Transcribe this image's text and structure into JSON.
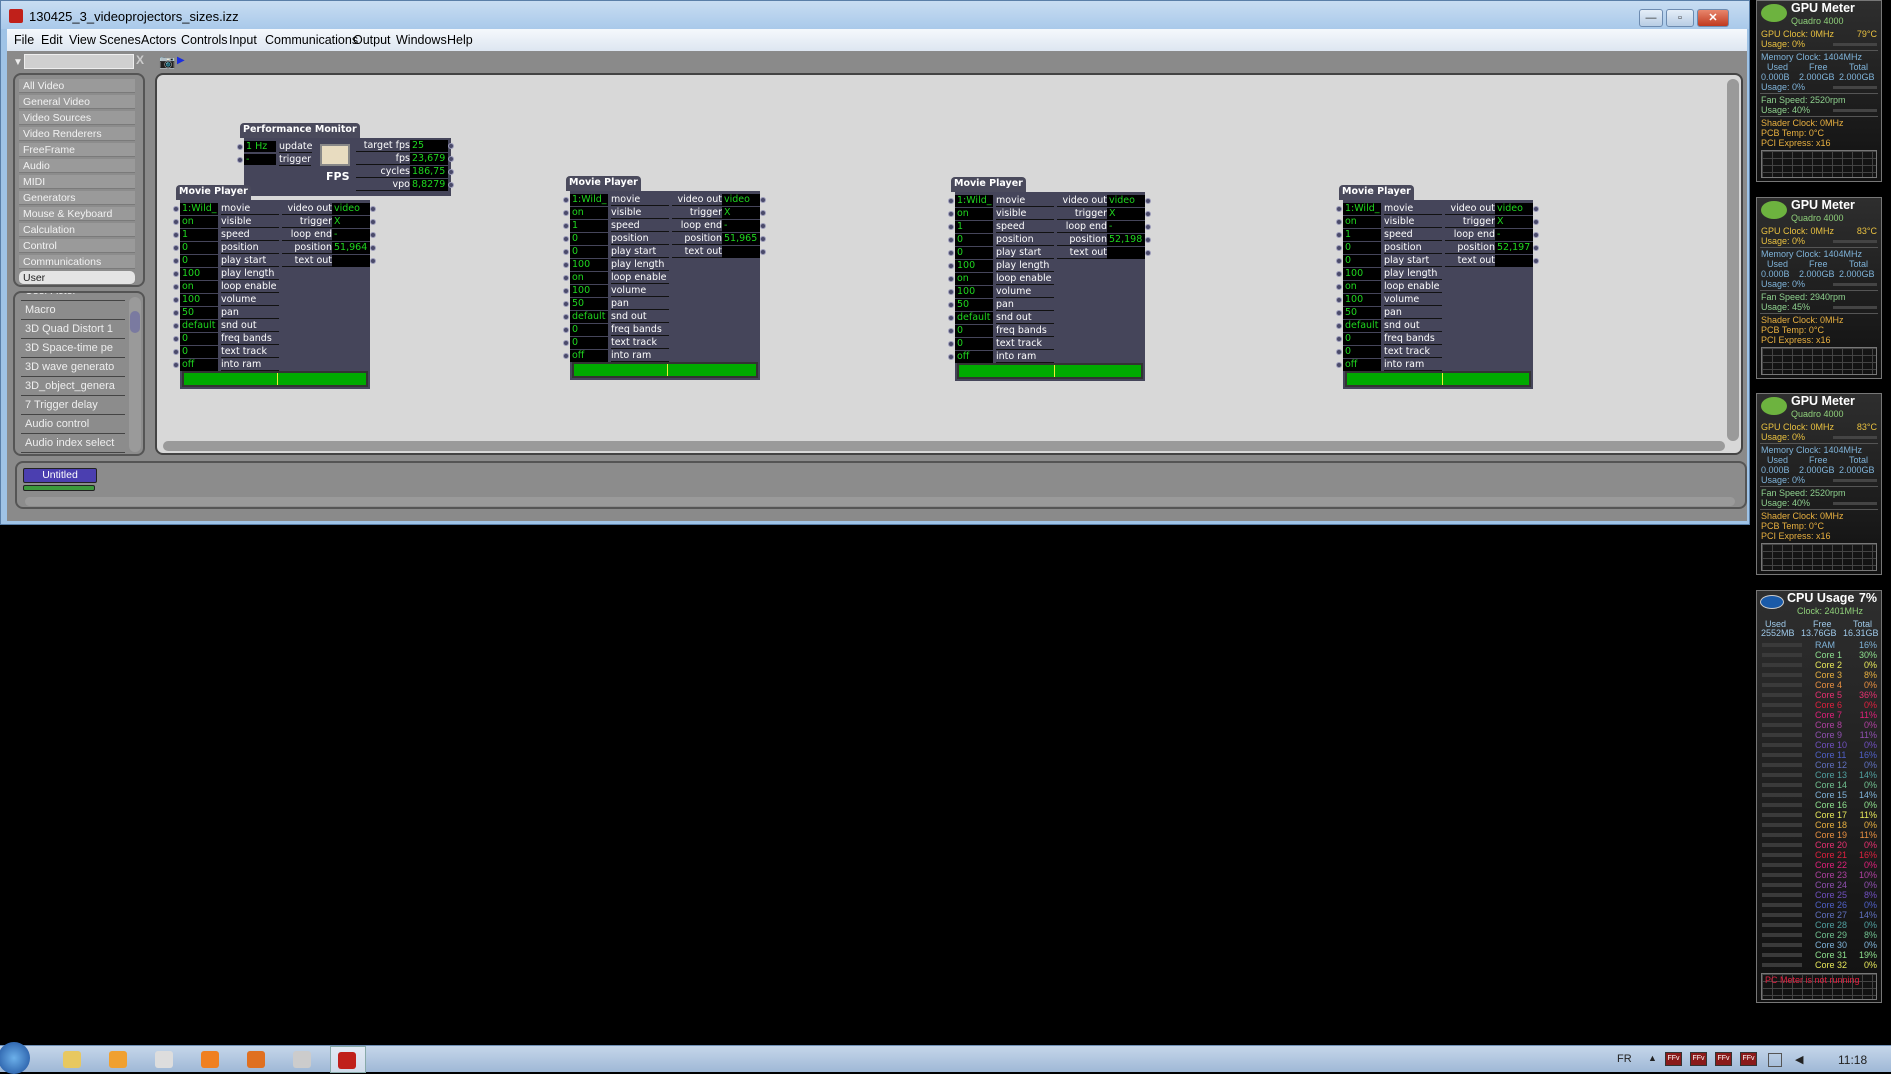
{
  "window": {
    "title": "130425_3_videoprojectors_sizes.izz",
    "controls": {
      "minimize": "—",
      "maximize": "▫",
      "close": "✕"
    },
    "menu": [
      "File",
      "Edit",
      "View",
      "Scenes",
      "Actors",
      "Controls",
      "Input",
      "Communications",
      "Output",
      "Windows",
      "Help"
    ]
  },
  "toolbar": {
    "search_value": "",
    "clear_label": "X"
  },
  "sidebar": {
    "categories": [
      "All Video",
      "General Video",
      "Video Sources",
      "Video Renderers",
      "FreeFrame",
      "Audio",
      "MIDI",
      "Generators",
      "Mouse & Keyboard",
      "Calculation",
      "Control",
      "Communications",
      "User"
    ],
    "selected": "User",
    "actors": [
      "User Actor",
      "Macro",
      "3D Quad Distort 1",
      "3D Space-time pe",
      "3D wave generato",
      "3D_object_genera",
      "7 Trigger delay",
      "Audio control",
      "Audio index select"
    ]
  },
  "performance_monitor": {
    "title": "Performance Monitor",
    "inputs": [
      {
        "value": "1 Hz",
        "label": "update"
      },
      {
        "value": "-",
        "label": "trigger"
      }
    ],
    "icon_label": "FPS",
    "outputs": [
      {
        "label": "target fps",
        "value": "25"
      },
      {
        "label": "fps",
        "value": "23,679"
      },
      {
        "label": "cycles",
        "value": "186,75"
      },
      {
        "label": "vpo",
        "value": "8,8279"
      }
    ]
  },
  "movie_players": [
    {
      "title": "Movie Player",
      "playhead": 0.51,
      "inputs": [
        {
          "value": "1:Wild_",
          "label": "movie"
        },
        {
          "value": "on",
          "label": "visible"
        },
        {
          "value": "1",
          "label": "speed"
        },
        {
          "value": "0",
          "label": "position"
        },
        {
          "value": "0",
          "label": "play start"
        },
        {
          "value": "100",
          "label": "play length"
        },
        {
          "value": "on",
          "label": "loop enable"
        },
        {
          "value": "100",
          "label": "volume"
        },
        {
          "value": "50",
          "label": "pan"
        },
        {
          "value": "default",
          "label": "snd out"
        },
        {
          "value": "0",
          "label": "freq bands"
        },
        {
          "value": "0",
          "label": "text track"
        },
        {
          "value": "off",
          "label": "into ram"
        }
      ],
      "outputs": [
        {
          "label": "video out",
          "value": "video"
        },
        {
          "label": "trigger",
          "value": "X"
        },
        {
          "label": "loop end",
          "value": "-"
        },
        {
          "label": "position",
          "value": "51,964"
        },
        {
          "label": "text out",
          "value": ""
        }
      ]
    },
    {
      "title": "Movie Player",
      "playhead": 0.51,
      "inputs": [
        {
          "value": "1:Wild_",
          "label": "movie"
        },
        {
          "value": "on",
          "label": "visible"
        },
        {
          "value": "1",
          "label": "speed"
        },
        {
          "value": "0",
          "label": "position"
        },
        {
          "value": "0",
          "label": "play start"
        },
        {
          "value": "100",
          "label": "play length"
        },
        {
          "value": "on",
          "label": "loop enable"
        },
        {
          "value": "100",
          "label": "volume"
        },
        {
          "value": "50",
          "label": "pan"
        },
        {
          "value": "default",
          "label": "snd out"
        },
        {
          "value": "0",
          "label": "freq bands"
        },
        {
          "value": "0",
          "label": "text track"
        },
        {
          "value": "off",
          "label": "into ram"
        }
      ],
      "outputs": [
        {
          "label": "video out",
          "value": "video"
        },
        {
          "label": "trigger",
          "value": "X"
        },
        {
          "label": "loop end",
          "value": "-"
        },
        {
          "label": "position",
          "value": "51,965"
        },
        {
          "label": "text out",
          "value": ""
        }
      ]
    },
    {
      "title": "Movie Player",
      "playhead": 0.52,
      "inputs": [
        {
          "value": "1:Wild_",
          "label": "movie"
        },
        {
          "value": "on",
          "label": "visible"
        },
        {
          "value": "1",
          "label": "speed"
        },
        {
          "value": "0",
          "label": "position"
        },
        {
          "value": "0",
          "label": "play start"
        },
        {
          "value": "100",
          "label": "play length"
        },
        {
          "value": "on",
          "label": "loop enable"
        },
        {
          "value": "100",
          "label": "volume"
        },
        {
          "value": "50",
          "label": "pan"
        },
        {
          "value": "default",
          "label": "snd out"
        },
        {
          "value": "0",
          "label": "freq bands"
        },
        {
          "value": "0",
          "label": "text track"
        },
        {
          "value": "off",
          "label": "into ram"
        }
      ],
      "outputs": [
        {
          "label": "video out",
          "value": "video"
        },
        {
          "label": "trigger",
          "value": "X"
        },
        {
          "label": "loop end",
          "value": "-"
        },
        {
          "label": "position",
          "value": "52,198"
        },
        {
          "label": "text out",
          "value": ""
        }
      ]
    },
    {
      "title": "Movie Player",
      "playhead": 0.52,
      "inputs": [
        {
          "value": "1:Wild_",
          "label": "movie"
        },
        {
          "value": "on",
          "label": "visible"
        },
        {
          "value": "1",
          "label": "speed"
        },
        {
          "value": "0",
          "label": "position"
        },
        {
          "value": "0",
          "label": "play start"
        },
        {
          "value": "100",
          "label": "play length"
        },
        {
          "value": "on",
          "label": "loop enable"
        },
        {
          "value": "100",
          "label": "volume"
        },
        {
          "value": "50",
          "label": "pan"
        },
        {
          "value": "default",
          "label": "snd out"
        },
        {
          "value": "0",
          "label": "freq bands"
        },
        {
          "value": "0",
          "label": "text track"
        },
        {
          "value": "off",
          "label": "into ram"
        }
      ],
      "outputs": [
        {
          "label": "video out",
          "value": "video"
        },
        {
          "label": "trigger",
          "value": "X"
        },
        {
          "label": "loop end",
          "value": "-"
        },
        {
          "label": "position",
          "value": "52,197"
        },
        {
          "label": "text out",
          "value": ""
        }
      ]
    }
  ],
  "scenes": {
    "items": [
      "Untitled"
    ]
  },
  "gpu_meters": [
    {
      "name": "GPU Meter",
      "model": "Quadro 4000",
      "gpu_clock": "GPU Clock: 0MHz",
      "temp": "79°C",
      "gpu_usage": "Usage: 0%",
      "gpu_usage_pct": 0,
      "mem_clock": "Memory Clock: 1404MHz",
      "mem_headers": [
        "Used",
        "Free",
        "Total"
      ],
      "mem_values": [
        "0.000B",
        "2.000GB",
        "2.000GB"
      ],
      "mem_usage": "Usage: 0%",
      "mem_usage_pct": 0,
      "fan": "Fan Speed: 2520rpm",
      "fan_usage": "Usage: 40%",
      "fan_usage_pct": 40,
      "shader": "Shader Clock: 0MHz",
      "pcb": "PCB Temp: 0°C",
      "pci": "PCI Express: x16"
    },
    {
      "name": "GPU Meter",
      "model": "Quadro 4000",
      "gpu_clock": "GPU Clock: 0MHz",
      "temp": "83°C",
      "gpu_usage": "Usage: 0%",
      "gpu_usage_pct": 0,
      "mem_clock": "Memory Clock: 1404MHz",
      "mem_headers": [
        "Used",
        "Free",
        "Total"
      ],
      "mem_values": [
        "0.000B",
        "2.000GB",
        "2.000GB"
      ],
      "mem_usage": "Usage: 0%",
      "mem_usage_pct": 0,
      "fan": "Fan Speed: 2940rpm",
      "fan_usage": "Usage: 45%",
      "fan_usage_pct": 45,
      "shader": "Shader Clock: 0MHz",
      "pcb": "PCB Temp: 0°C",
      "pci": "PCI Express: x16"
    },
    {
      "name": "GPU Meter",
      "model": "Quadro 4000",
      "gpu_clock": "GPU Clock: 0MHz",
      "temp": "83°C",
      "gpu_usage": "Usage: 0%",
      "gpu_usage_pct": 0,
      "mem_clock": "Memory Clock: 1404MHz",
      "mem_headers": [
        "Used",
        "Free",
        "Total"
      ],
      "mem_values": [
        "0.000B",
        "2.000GB",
        "2.000GB"
      ],
      "mem_usage": "Usage: 0%",
      "mem_usage_pct": 0,
      "fan": "Fan Speed: 2520rpm",
      "fan_usage": "Usage: 40%",
      "fan_usage_pct": 40,
      "shader": "Shader Clock: 0MHz",
      "pcb": "PCB Temp: 0°C",
      "pci": "PCI Express: x16"
    }
  ],
  "cpu_meter": {
    "name": "CPU Usage",
    "total": "7%",
    "clock": "Clock: 2401MHz",
    "mem_headers": [
      "Used",
      "Free",
      "Total"
    ],
    "mem_values": [
      "2552MB",
      "13.76GB",
      "16.31GB"
    ],
    "rows": [
      {
        "label": "RAM",
        "value": "16%",
        "pct": 16
      },
      {
        "label": "Core 1",
        "value": "30%",
        "pct": 30
      },
      {
        "label": "Core 2",
        "value": "0%",
        "pct": 0
      },
      {
        "label": "Core 3",
        "value": "8%",
        "pct": 8
      },
      {
        "label": "Core 4",
        "value": "0%",
        "pct": 0
      },
      {
        "label": "Core 5",
        "value": "36%",
        "pct": 36
      },
      {
        "label": "Core 6",
        "value": "0%",
        "pct": 0
      },
      {
        "label": "Core 7",
        "value": "11%",
        "pct": 11
      },
      {
        "label": "Core 8",
        "value": "0%",
        "pct": 0
      },
      {
        "label": "Core 9",
        "value": "11%",
        "pct": 11
      },
      {
        "label": "Core 10",
        "value": "0%",
        "pct": 0
      },
      {
        "label": "Core 11",
        "value": "16%",
        "pct": 16
      },
      {
        "label": "Core 12",
        "value": "0%",
        "pct": 0
      },
      {
        "label": "Core 13",
        "value": "14%",
        "pct": 14
      },
      {
        "label": "Core 14",
        "value": "0%",
        "pct": 0
      },
      {
        "label": "Core 15",
        "value": "14%",
        "pct": 14
      },
      {
        "label": "Core 16",
        "value": "0%",
        "pct": 0
      },
      {
        "label": "Core 17",
        "value": "11%",
        "pct": 11
      },
      {
        "label": "Core 18",
        "value": "0%",
        "pct": 0
      },
      {
        "label": "Core 19",
        "value": "11%",
        "pct": 11
      },
      {
        "label": "Core 20",
        "value": "0%",
        "pct": 0
      },
      {
        "label": "Core 21",
        "value": "16%",
        "pct": 16
      },
      {
        "label": "Core 22",
        "value": "0%",
        "pct": 0
      },
      {
        "label": "Core 23",
        "value": "10%",
        "pct": 10
      },
      {
        "label": "Core 24",
        "value": "0%",
        "pct": 0
      },
      {
        "label": "Core 25",
        "value": "8%",
        "pct": 8
      },
      {
        "label": "Core 26",
        "value": "0%",
        "pct": 0
      },
      {
        "label": "Core 27",
        "value": "14%",
        "pct": 14
      },
      {
        "label": "Core 28",
        "value": "0%",
        "pct": 0
      },
      {
        "label": "Core 29",
        "value": "8%",
        "pct": 8
      },
      {
        "label": "Core 30",
        "value": "0%",
        "pct": 0
      },
      {
        "label": "Core 31",
        "value": "19%",
        "pct": 19
      },
      {
        "label": "Core 32",
        "value": "0%",
        "pct": 0
      }
    ],
    "graph_message": "PC Meter is not running",
    "row_colors": [
      "#7fb3d9",
      "#8ee08e",
      "#e8e85a",
      "#e8b040",
      "#e89040",
      "#e83070",
      "#e02040",
      "#e0207a",
      "#b040a0",
      "#9050b0",
      "#7050c0",
      "#5060c8",
      "#6070c0",
      "#50a0a0",
      "#70c090"
    ]
  },
  "taskbar": {
    "apps": [
      "windows-explorer",
      "media-player",
      "media-player-classic",
      "vlc",
      "firefox",
      "snipping-tool",
      "isadora"
    ],
    "language": "FR",
    "clock": "11:18",
    "tray_label": "FFv"
  }
}
